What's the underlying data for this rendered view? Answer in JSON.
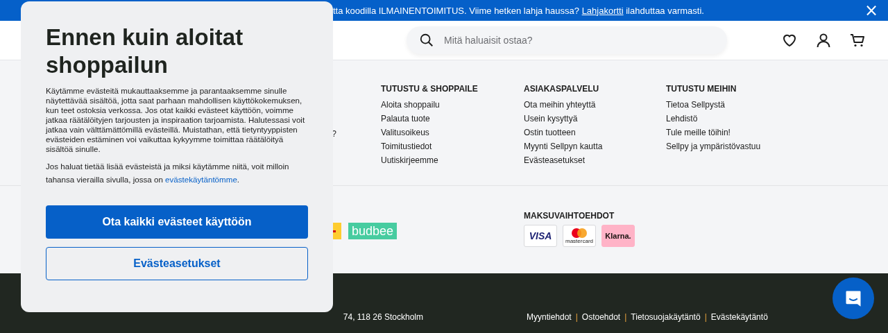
{
  "banner": {
    "text_before": "tta koodilla ILMAINENTOIMITUS. Viime hetken lahja haussa? ",
    "link": "Lahjakortti",
    "text_after": " ilahduttaa varmasti.",
    "close": "×"
  },
  "header": {
    "search": {
      "placeholder": "Mitä haluaisit ostaa?"
    }
  },
  "footer_columns": [
    {
      "items": [
        "?"
      ]
    },
    {
      "heading": "TUTUSTU & SHOPPAILE",
      "items": [
        "Aloita shoppailu",
        "Palauta tuote",
        "Valitusoikeus",
        "Toimitustiedot",
        "Uutiskirjeemme"
      ]
    },
    {
      "heading": "ASIAKASPALVELU",
      "items": [
        "Ota meihin yhteyttä",
        "Usein kysyttyä",
        "Ostin tuotteen",
        "Myynti Sellpyn kautta",
        "Evästeasetukset"
      ]
    },
    {
      "heading": "TUTUSTU MEIHIN",
      "items": [
        "Tietoa Sellpystä",
        "Lehdistö",
        "Tule meille töihin!",
        "Sellpy ja ympäristövastuu"
      ]
    }
  ],
  "delivery": {
    "logos": [
      {
        "kind": "stripe"
      },
      {
        "kind": "wordmark",
        "label": "budbee"
      }
    ]
  },
  "payments": {
    "heading": "MAKSUVAIHTOEHDOT",
    "methods": [
      {
        "kind": "visa",
        "label": "VISA"
      },
      {
        "kind": "mastercard",
        "label": "mastercard"
      },
      {
        "kind": "klarna",
        "label": "Klarna."
      }
    ]
  },
  "bottom_bar": {
    "address": "74, 118 26 Stockholm",
    "links": [
      "Myyntiehdot",
      "Ostoehdot",
      "Tietosuojakäytäntö",
      "Evästekäytäntö"
    ],
    "separator": "|"
  },
  "cookie_dialog": {
    "title": "Ennen kuin aloitat shoppailun",
    "paragraph": "Käytämme evästeitä mukauttaaksemme ja parantaaksemme sinulle näytettävää sisältöä, jotta saat parhaan mahdollisen käyttökokemuksen, kun teet ostoksia verkossa. Jos otat kaikki evästeet käyttöön, voimme jatkaa räätälöityjen tarjousten ja inspiraation tarjoamista. Halutessasi voit jatkaa vain välttämättömillä evästeillä. Muistathan, että tietyntyyppisten evästeiden estäminen voi vaikuttaa kykyymme toimittaa räätälöityä sisältöä sinulle.",
    "note": {
      "text": "Jos haluat tietää lisää evästeistä ja miksi käytämme niitä, voit milloin tahansa vierailla sivulla, jossa on ",
      "link": "evästekäytäntömme",
      "after": "."
    },
    "buttons": [
      {
        "kind": "primary",
        "label": "Ota kaikki evästeet käyttöön"
      },
      {
        "kind": "secondary",
        "label": "Evästeasetukset"
      }
    ]
  }
}
